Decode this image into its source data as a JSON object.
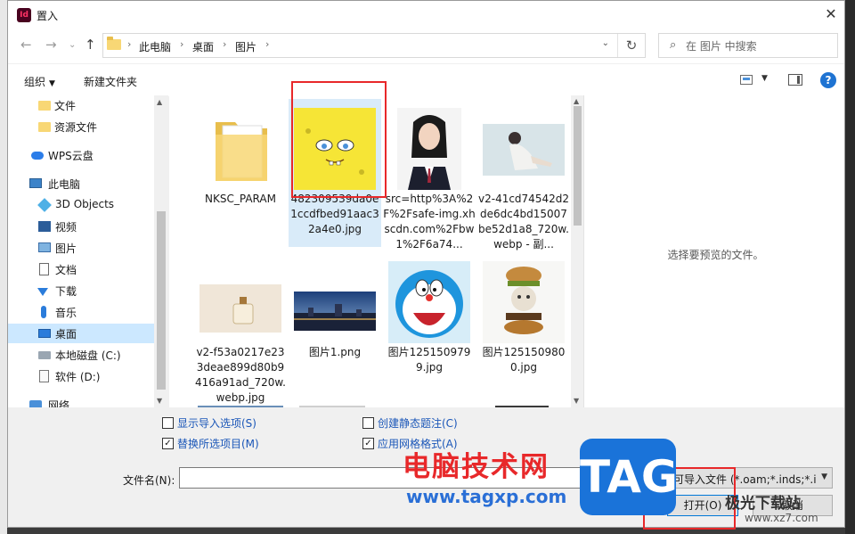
{
  "window": {
    "app_icon": "Id",
    "title": "置入",
    "close_glyph": "✕"
  },
  "address": {
    "crumbs": [
      "此电脑",
      "桌面",
      "图片"
    ],
    "search_placeholder": "在 图片 中搜索"
  },
  "toolbar": {
    "organize_label": "组织",
    "new_folder_label": "新建文件夹",
    "help_label": "?"
  },
  "nav": {
    "items": [
      {
        "label": "文件",
        "icon": "folder-icon"
      },
      {
        "label": "资源文件",
        "icon": "folder-icon"
      },
      {
        "label": "WPS云盘",
        "icon": "cloud-icon"
      },
      {
        "label": "此电脑",
        "icon": "computer-icon"
      },
      {
        "label": "3D Objects",
        "icon": "cube-icon"
      },
      {
        "label": "视频",
        "icon": "video-icon"
      },
      {
        "label": "图片",
        "icon": "picture-icon"
      },
      {
        "label": "文档",
        "icon": "document-icon"
      },
      {
        "label": "下载",
        "icon": "download-icon"
      },
      {
        "label": "音乐",
        "icon": "music-icon"
      },
      {
        "label": "桌面",
        "icon": "desktop-icon"
      },
      {
        "label": "本地磁盘 (C:)",
        "icon": "disk-icon"
      },
      {
        "label": "软件 (D:)",
        "icon": "document-icon"
      },
      {
        "label": "网络",
        "icon": "network-icon"
      }
    ]
  },
  "files": [
    {
      "name": "NKSC_PARAM",
      "thumb": "folder-icon"
    },
    {
      "name": "482309539da0e1ccdfbed91aac32a4e0.jpg",
      "thumb": "spongebob-image"
    },
    {
      "name": "src=http%3A%2F%2Fsafe-img.xhscdn.com%2Fbw1%2F6a74...",
      "thumb": "portrait-image"
    },
    {
      "name": "v2-41cd74542d2de6dc4bd15007be52d1a8_720w.webp - 副...",
      "thumb": "woman-photo-image"
    },
    {
      "name": "v2-f53a0217e233deae899d80b9416a91ad_720w.webp.jpg",
      "thumb": "perfume-image"
    },
    {
      "name": "图片1.png",
      "thumb": "city-night-image"
    },
    {
      "name": "图片1251509799.jpg",
      "thumb": "doraemon-image"
    },
    {
      "name": "图片1251509800.jpg",
      "thumb": "burger-cat-image"
    }
  ],
  "preview": {
    "message": "选择要预览的文件。"
  },
  "options": {
    "show_import_options": "显示导入选项(S)",
    "replace_selected": "替换所选项目(M)",
    "create_static_caption": "创建静态题注(C)",
    "apply_grid_format": "应用网格格式(A)",
    "replace_selected_checked": true,
    "apply_grid_format_checked": true
  },
  "footer": {
    "filename_label": "文件名(N):",
    "filename_value": "",
    "filetype_value": "可导入文件 (*.oam;*.inds;*.idr",
    "open_label": "打开(O)",
    "cancel_label": "取消"
  },
  "watermark": {
    "site_cn": "电脑技术网",
    "url": "www.tagxp.com",
    "badge": "TAG",
    "site2_cn": "极光下载站",
    "site2_url": "www.xz7.com"
  },
  "colors": {
    "accent": "#0078d7",
    "annotation_red": "#e8282a",
    "selection": "#cce8ff"
  }
}
